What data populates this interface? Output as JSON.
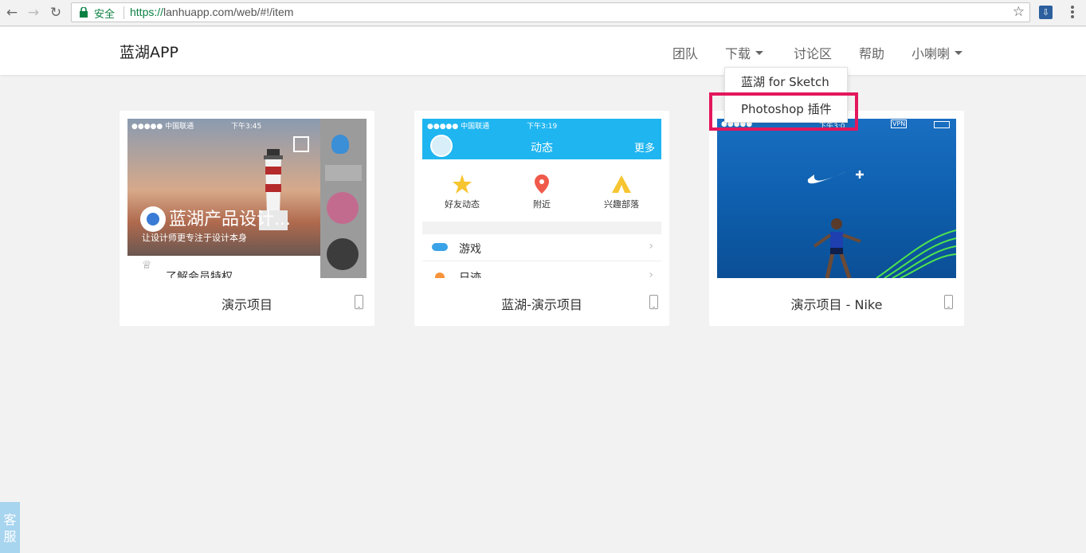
{
  "browser": {
    "secure_label": "安全",
    "url_scheme": "https://",
    "url_rest": "lanhuapp.com/web/#!/item"
  },
  "header": {
    "brand": "蓝湖APP",
    "nav": {
      "team": "团队",
      "download": "下载",
      "forum": "讨论区",
      "help": "帮助",
      "user": "小喇喇"
    }
  },
  "dropdown": {
    "items": [
      "蓝湖 for Sketch",
      "Photoshop 插件"
    ],
    "highlight_color": "#e3175c"
  },
  "cards": [
    {
      "title": "演示项目",
      "thumb": {
        "status_carrier": "●●●●● 中国联通",
        "status_time": "下午3:45",
        "overlay_title": "蓝湖产品设计...",
        "overlay_sub": "让设计师更专注于设计本身",
        "bottom_text": "了解会员特权"
      }
    },
    {
      "title": "蓝湖-演示项目",
      "thumb": {
        "status_carrier": "●●●●● 中国联通",
        "status_time": "下午3:19",
        "title": "动态",
        "more": "更多",
        "quick": [
          "好友动态",
          "附近",
          "兴趣部落"
        ],
        "list": [
          "游戏",
          "日迹"
        ]
      }
    },
    {
      "title": "演示项目 - Nike",
      "thumb": {
        "status_time": "下午3:0",
        "vpn": "VPN"
      }
    }
  ],
  "support": {
    "label_line1": "客",
    "label_line2": "服"
  }
}
